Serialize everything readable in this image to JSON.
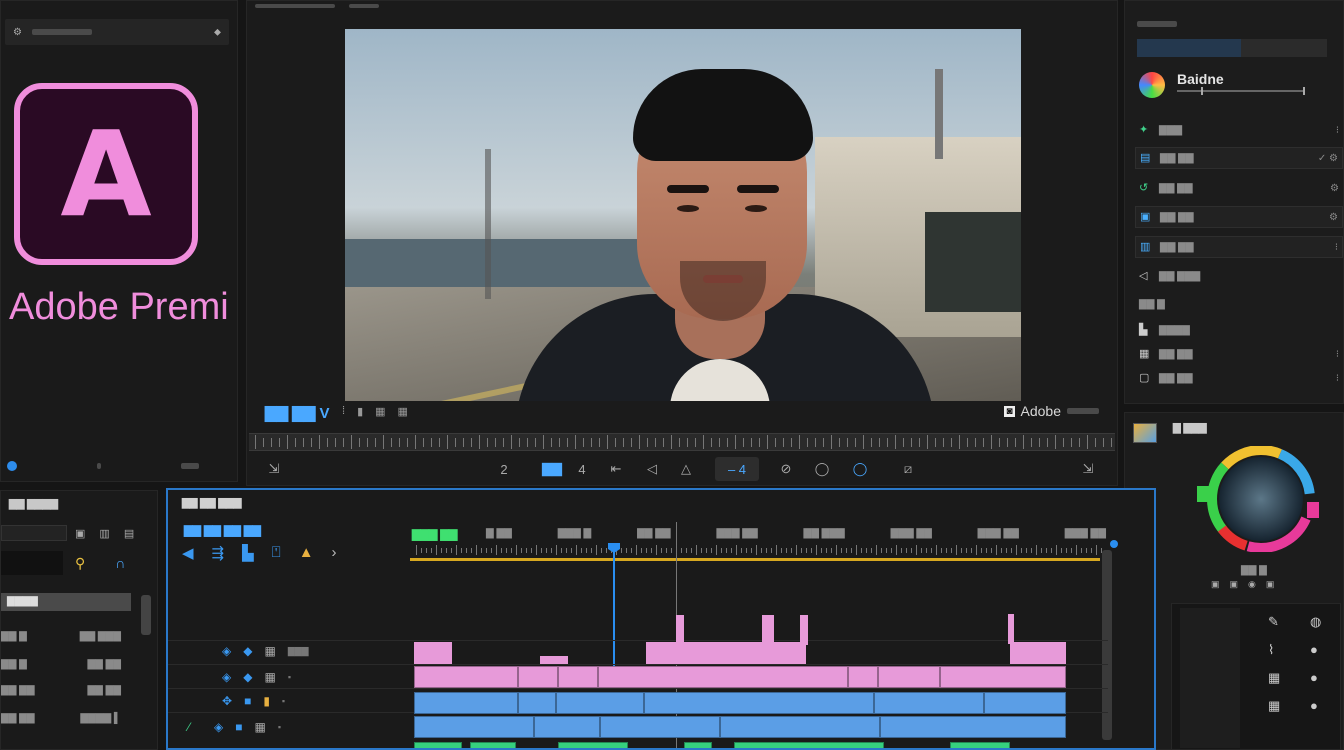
{
  "app": {
    "brand_name": "Adobe Premi",
    "logo_letter": "A",
    "accent_color": "#2d8ceb",
    "brand_color": "#f08ddc"
  },
  "monitor": {
    "label": "▇▇ ▇▇ V",
    "brand": "Adobe",
    "transport": [
      "2",
      "▇▇",
      "4",
      "⇤",
      "◁",
      "△",
      "‒ 4",
      "⊘",
      "◯",
      "◯",
      "⧄",
      "⇲"
    ]
  },
  "properties_panel": {
    "title": "Baidne",
    "items": [
      {
        "label": "▇▇▇",
        "end": "⁝"
      },
      {
        "label": "▇▇ ▇▇",
        "end": "✓ ⚙"
      },
      {
        "label": "▇▇ ▇▇",
        "end": "⚙"
      },
      {
        "label": "▇▇ ▇▇",
        "end": "⚙"
      },
      {
        "label": "▇▇ ▇▇",
        "end": "⁝"
      },
      {
        "label": "▇▇ ▇▇▇",
        "end": ""
      },
      {
        "label": "▇▇ ▇",
        "end": ""
      },
      {
        "label": "▇▇▇▇",
        "end": ""
      },
      {
        "label": "▇▇ ▇▇",
        "end": "⁝"
      },
      {
        "label": "▇▇ ▇▇",
        "end": "⁝"
      }
    ]
  },
  "color_panel": {
    "title": "▇ ▇▇▇",
    "label": "▇▇ ▇"
  },
  "project_panel": {
    "title": "▇▇ ▇▇▇▇",
    "selected_item": "▇▇▇▇",
    "rows": [
      {
        "left": "▇▇ ▇",
        "right": "▇▇ ▇▇▇"
      },
      {
        "left": "▇▇ ▇",
        "right": "▇▇ ▇▇"
      },
      {
        "left": "▇▇ ▇▇",
        "right": "▇▇ ▇▇"
      },
      {
        "left": "▇▇ ▇▇",
        "right": "▇▇▇▇ ▌"
      }
    ]
  },
  "timeline": {
    "title": "▇▇ ▇▇ ▇▇▇",
    "subtitle": "▇▇ ▇▇ ▇▇ ▇▇",
    "timecode": "▇▇▇ ▇▇",
    "ruler_labels": [
      "▇ ▇▇",
      "▇▇▇ ▇",
      "▇▇ ▇▇",
      "▇▇▇ ▇▇",
      "▇▇ ▇▇▇",
      "▇▇▇ ▇▇",
      "▇▇▇ ▇▇",
      "▇▇▇ ▇▇"
    ],
    "track_label": "▇▇▇"
  }
}
